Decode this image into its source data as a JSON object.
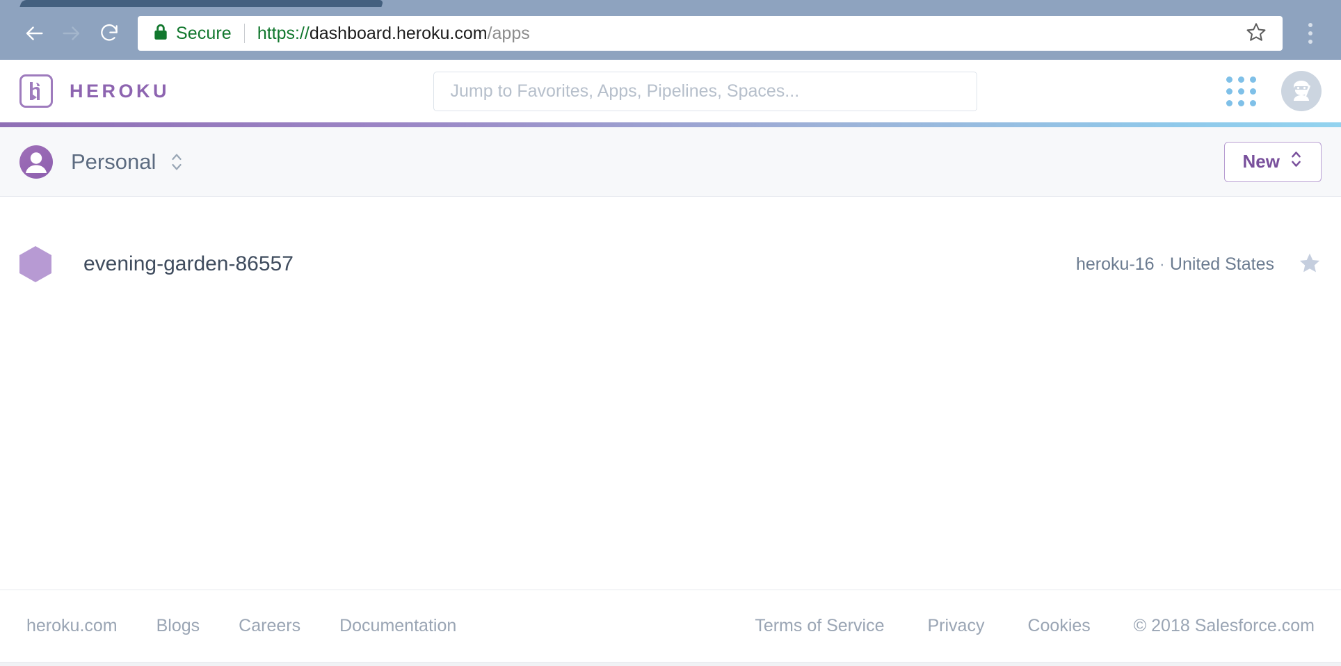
{
  "browser": {
    "back_icon": "back-arrow-icon",
    "forward_icon": "forward-arrow-icon",
    "reload_icon": "reload-icon",
    "security_label": "Secure",
    "lock_icon": "lock-icon",
    "url": {
      "scheme": "https://",
      "host": "dashboard.heroku.com",
      "path": "/apps",
      "full": "https://dashboard.heroku.com/apps"
    },
    "bookmark_icon": "star-outline-icon",
    "menu_icon": "kebab-menu-icon",
    "toolbar_bg": "#8ea3bf"
  },
  "header": {
    "logo_mark": "heroku-logo-icon",
    "wordmark": "HEROKU",
    "brand_color": "#8d64b0",
    "search": {
      "placeholder": "Jump to Favorites, Apps, Pipelines, Spaces...",
      "value": ""
    },
    "app_switcher_icon": "grid-apps-icon",
    "avatar_icon": "ninja-avatar-icon",
    "accent_gradient_from": "#8f6fb5",
    "accent_gradient_to": "#93d3ef"
  },
  "toolbar": {
    "team_avatar_icon": "person-avatar-icon",
    "team_name": "Personal",
    "team_switcher_icon": "up-down-chevron-icon",
    "new_button": {
      "label": "New",
      "chevron_icon": "up-down-chevron-icon",
      "color": "#79509c"
    }
  },
  "apps": {
    "rows": [
      {
        "icon": "hexagon-app-icon",
        "name": "evening-garden-86557",
        "stack": "heroku-16",
        "separator": "·",
        "region": "United States",
        "favorite_icon": "star-filled-icon",
        "favorited": false
      }
    ]
  },
  "footer": {
    "left_links": [
      {
        "label": "heroku.com"
      },
      {
        "label": "Blogs"
      },
      {
        "label": "Careers"
      },
      {
        "label": "Documentation"
      }
    ],
    "right_links": [
      {
        "label": "Terms of Service"
      },
      {
        "label": "Privacy"
      },
      {
        "label": "Cookies"
      },
      {
        "label": "© 2018 Salesforce.com"
      }
    ]
  }
}
